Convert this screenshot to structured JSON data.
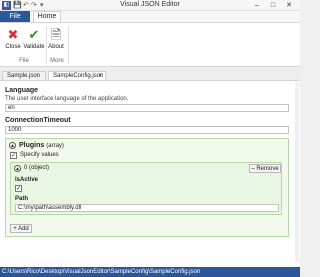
{
  "window": {
    "title": "Visual JSON Editor",
    "minimize": "–",
    "maximize": "□",
    "close": "✕"
  },
  "qat": {
    "save": "💾",
    "undo": "↶",
    "redo": "↷",
    "more": "▾"
  },
  "ribbon_tabs": {
    "file": "File",
    "home": "Home"
  },
  "ribbon": {
    "close_label": "Close",
    "validate_label": "Validate",
    "about_label": "About",
    "group_file": "File",
    "group_more": "More"
  },
  "doc_tabs": [
    {
      "label": "Sample.json"
    },
    {
      "label": "SampleConfig.json",
      "close": "×"
    }
  ],
  "form": {
    "language_label": "Language",
    "language_desc": "The user interface language of the application.",
    "language_value": "en",
    "timeout_label": "ConnectionTimeout",
    "timeout_value": "1000",
    "plugins_label": "Plugins",
    "plugins_type": "(array)",
    "specify_values_label": "Specify values",
    "item_label": "0 (object)",
    "remove_label": "– Remove",
    "isactive_label": "IsActive",
    "path_label": "Path",
    "path_value": "C:\\my\\path\\assembly.dll",
    "add_label": "+ Add"
  },
  "status": {
    "path": "C:\\Users\\Rico\\Desktop\\VisualJsonEditor\\SampleConfig\\SampleConfig.json"
  },
  "colors": {
    "accent": "#2b579a",
    "close_red": "#d13438",
    "validate_green": "#2e8b2e",
    "group_border": "#b6d9a6"
  }
}
